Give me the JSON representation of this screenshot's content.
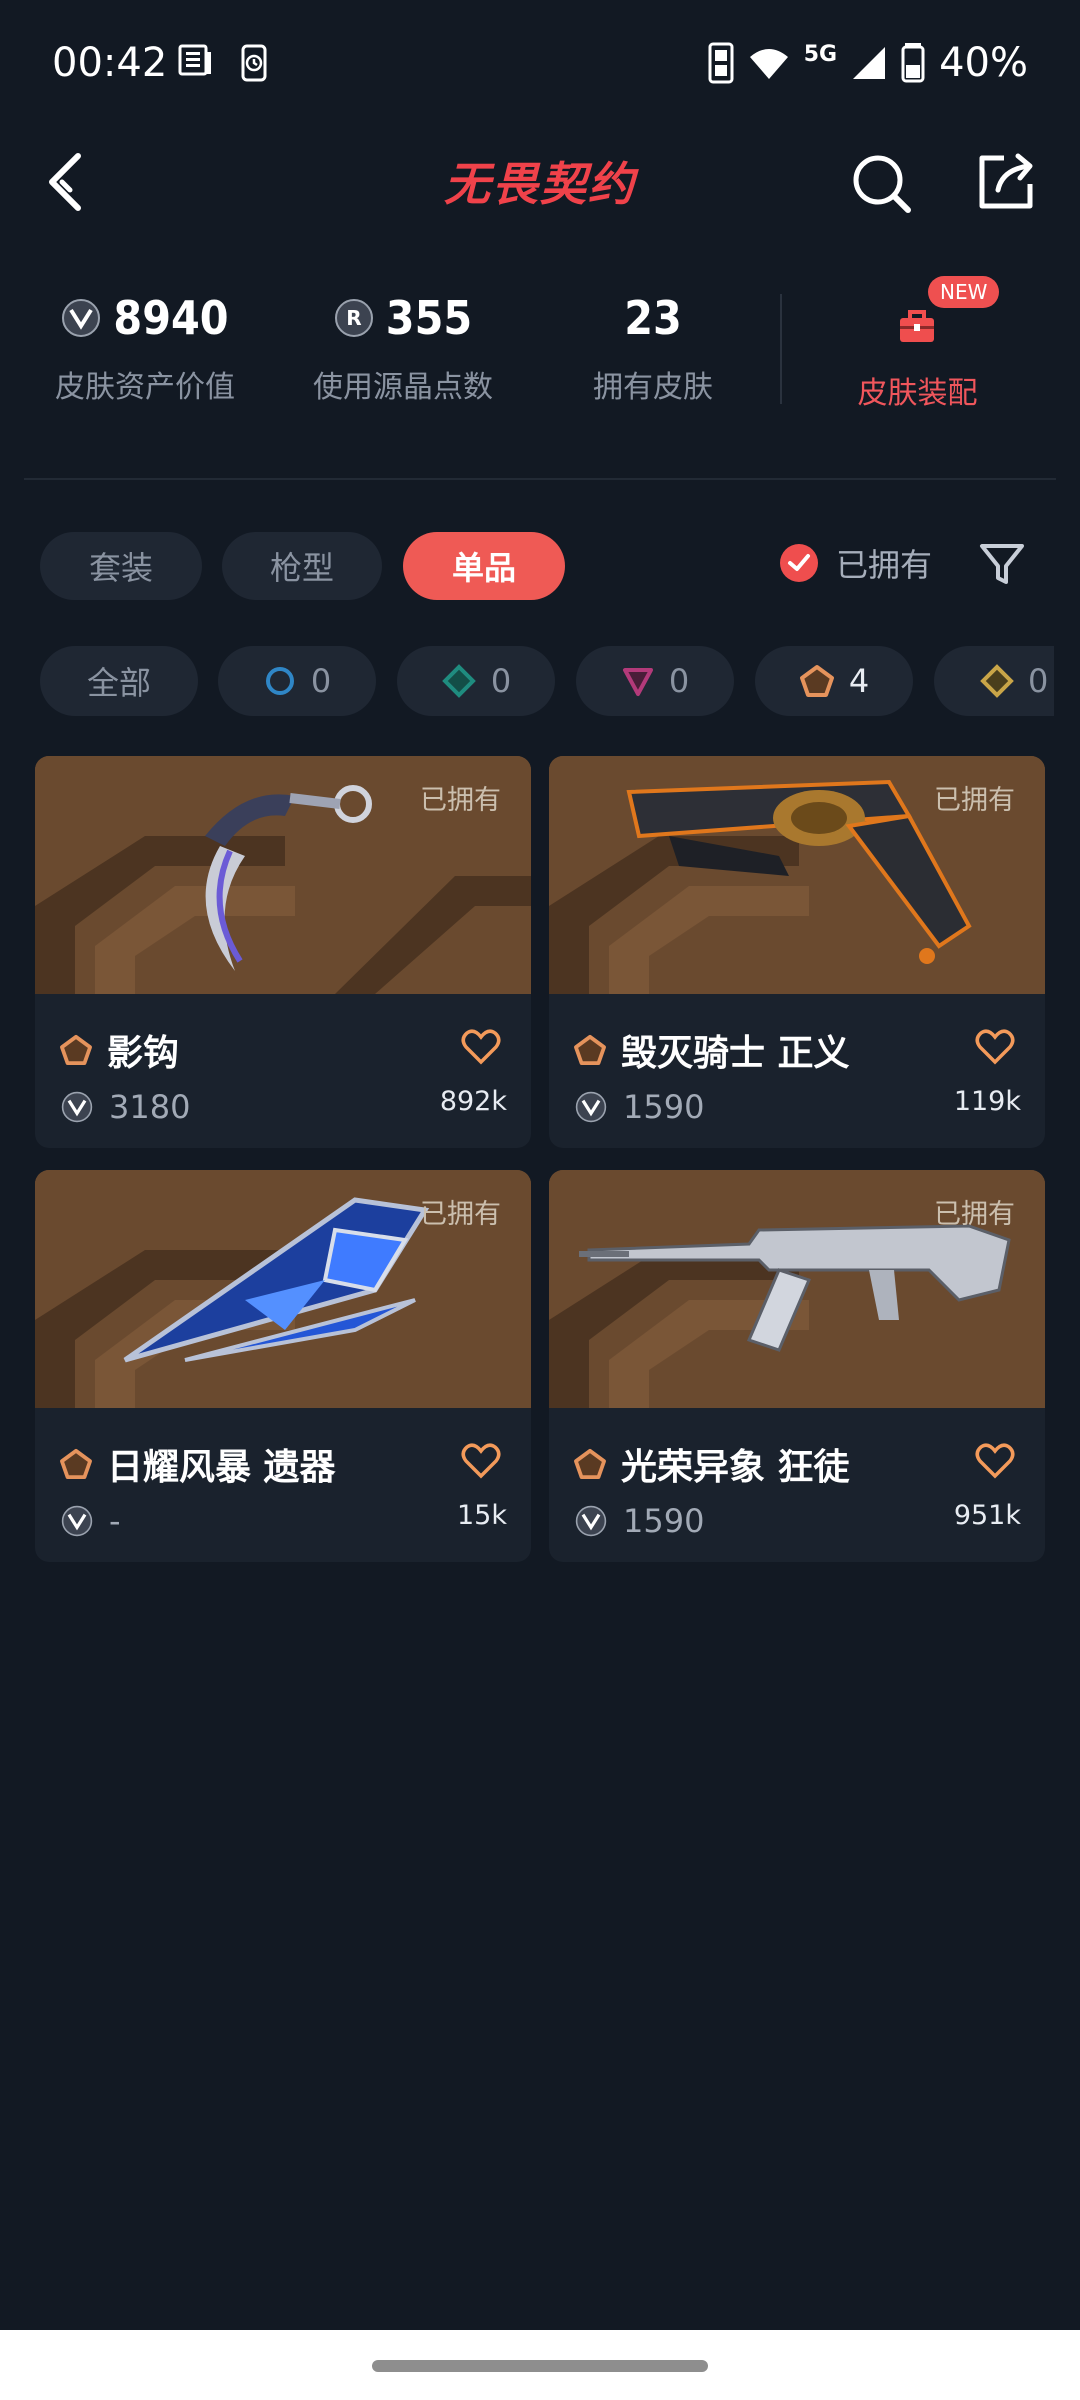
{
  "status_bar": {
    "time": "00:42",
    "network": "5G",
    "battery": "40%"
  },
  "header": {
    "title": "无畏契约"
  },
  "stats": [
    {
      "value": "8940",
      "label": "皮肤资产价值",
      "icon": "vp-icon"
    },
    {
      "value": "355",
      "label": "使用源晶点数",
      "icon": "radianite-icon"
    },
    {
      "value": "23",
      "label": "拥有皮肤"
    }
  ],
  "equip": {
    "label": "皮肤装配",
    "badge": "NEW",
    "icon": "briefcase-icon",
    "color": "#f0565c"
  },
  "category_tabs": [
    "套装",
    "枪型",
    "单品"
  ],
  "active_tab": "单品",
  "owned_filter": {
    "label": "已拥有",
    "checked": true
  },
  "tier_chips": [
    {
      "label": "全部"
    },
    {
      "count": "0",
      "tier": "select",
      "color": "#2f86c6"
    },
    {
      "count": "0",
      "tier": "deluxe",
      "color": "#1f8c7f"
    },
    {
      "count": "0",
      "tier": "premium",
      "color": "#b33a7a"
    },
    {
      "count": "4",
      "tier": "exclusive",
      "color": "#e5935c"
    },
    {
      "count": "0",
      "tier": "ultra",
      "color": "#c9a548"
    }
  ],
  "cards": [
    {
      "name": "影钩",
      "price": "3180",
      "likes": "892k",
      "owned": "已拥有",
      "weapon": "karambit-knife"
    },
    {
      "name": "毁灭骑士 正义",
      "price": "1590",
      "likes": "119k",
      "owned": "已拥有",
      "weapon": "sheriff-revolver"
    },
    {
      "name": "日耀风暴 遗器",
      "price": "-",
      "likes": "15k",
      "owned": "已拥有",
      "weapon": "blade-relic"
    },
    {
      "name": "光荣异象 狂徒",
      "price": "1590",
      "likes": "951k",
      "owned": "已拥有",
      "weapon": "vandal-rifle"
    }
  ],
  "colors": {
    "accent": "#ef5a55",
    "background": "#121923",
    "card": "#1a222d"
  }
}
